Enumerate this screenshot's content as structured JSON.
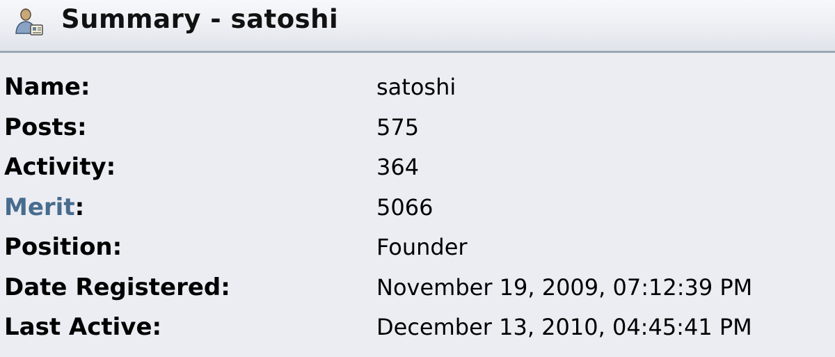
{
  "header": {
    "title": "Summary - satoshi",
    "icon": "user-profile-icon"
  },
  "profile": {
    "rows": [
      {
        "label": "Name:",
        "value": "satoshi"
      },
      {
        "label": "Posts:",
        "value": "575"
      },
      {
        "label": "Activity:",
        "value": "364"
      },
      {
        "label_link": "Merit",
        "label_suffix": ":",
        "value": "5066"
      },
      {
        "label": "Position:",
        "value": "Founder"
      },
      {
        "label": "Date Registered:",
        "value": "November 19, 2009, 07:12:39 PM"
      },
      {
        "label": "Last Active:",
        "value": "December 13, 2010, 04:45:41 PM"
      }
    ]
  },
  "colors": {
    "background": "#ecedf3",
    "link": "#476c8e",
    "header_border": "#9aa6b4"
  }
}
